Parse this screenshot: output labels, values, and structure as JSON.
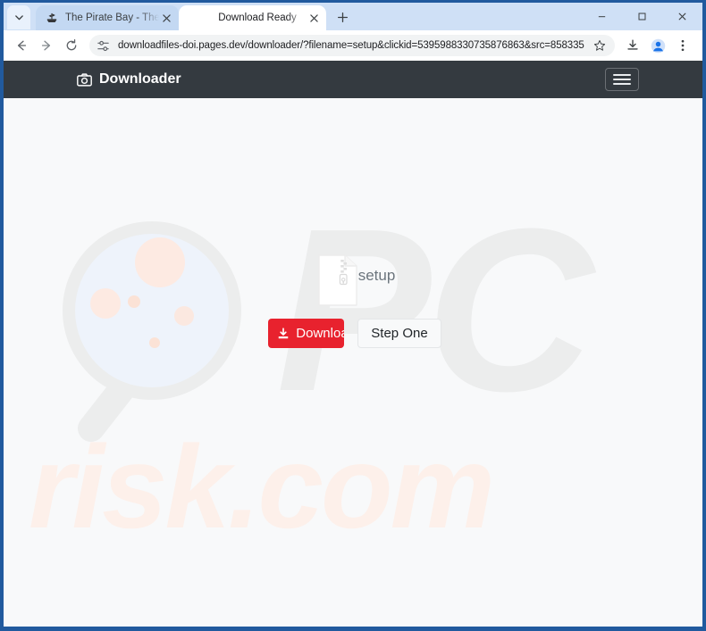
{
  "browser": {
    "tabs": [
      {
        "title": "The Pirate Bay - The galaxy's m",
        "favicon": "pirate-ship-icon",
        "active": false
      },
      {
        "title": "Download Ready",
        "favicon": "none",
        "active": true
      }
    ],
    "newtab_label": "+",
    "tabstrip_chevron": "chevron-down-icon",
    "window_controls": {
      "minimize": "minimize-icon",
      "maximize": "maximize-icon",
      "close": "close-icon"
    },
    "toolbar": {
      "back": "back-arrow-icon",
      "forward": "forward-arrow-icon",
      "reload": "reload-icon",
      "site_info": "tune-sliders-icon",
      "url": "downloadfiles-doi.pages.dev/downloader/?filename=setup&clickid=5395988330735876863&src=858335",
      "bookmark": "star-icon",
      "downloads": "download-tray-icon",
      "profile": "profile-avatar-icon",
      "menu": "three-dot-menu-icon"
    }
  },
  "site": {
    "navbar": {
      "brand_label": "Downloader",
      "brand_icon": "camera-icon",
      "toggle_icon": "hamburger-menu-icon",
      "background": "#343a40"
    },
    "main": {
      "file_icon": "zip-file-icon",
      "filename": "setup",
      "download_button": {
        "label": "Download",
        "icon": "download-icon",
        "color": "#e8222e"
      },
      "step_button": {
        "label": "Step One",
        "color": "#f8f9fa"
      }
    },
    "watermark": {
      "logo_text": "PC",
      "domain_text": "risk.com",
      "glass_icon": "magnifier-icon"
    }
  }
}
